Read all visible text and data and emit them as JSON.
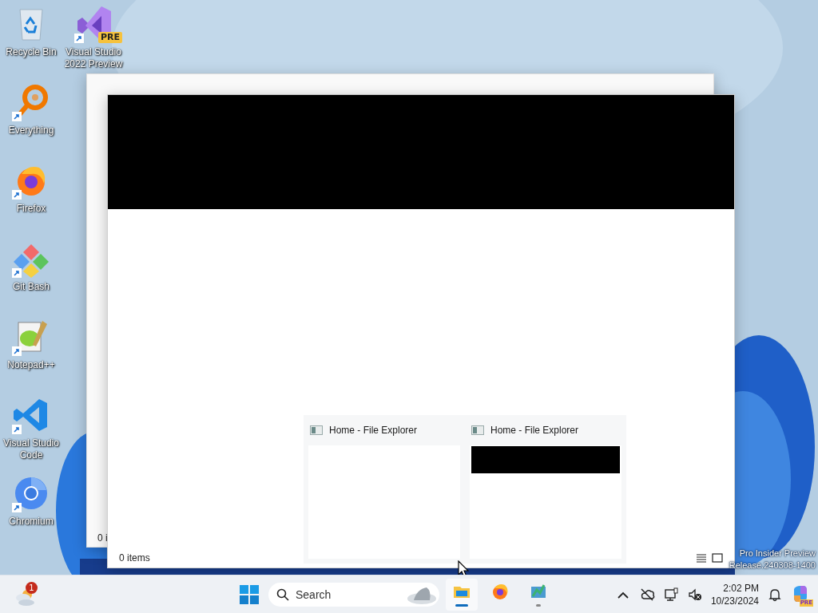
{
  "desktop": {
    "icons": [
      {
        "label": "Recycle Bin",
        "kind": "recycle",
        "shortcut": false
      },
      {
        "label": "Everything",
        "kind": "everything",
        "shortcut": true
      },
      {
        "label": "Firefox",
        "kind": "firefox",
        "shortcut": true
      },
      {
        "label": "Git Bash",
        "kind": "git",
        "shortcut": true
      },
      {
        "label": "Notepad++",
        "kind": "notepad",
        "shortcut": true
      },
      {
        "label": "Visual Studio Code",
        "kind": "vscode",
        "shortcut": true
      },
      {
        "label": "Chromium",
        "kind": "chromium",
        "shortcut": true
      },
      {
        "label": "Visual Studio 2022 Preview",
        "kind": "vs",
        "shortcut": true,
        "badge": "PRE"
      }
    ],
    "build_text": [
      "Pro Insider Preview",
      "Release.240308-1400"
    ]
  },
  "windows": [
    {
      "kind": "back",
      "status": "0 i"
    },
    {
      "kind": "front",
      "status": "0 items"
    }
  ],
  "thumbnails": [
    {
      "title": "Home - File Explorer",
      "redacted": false
    },
    {
      "title": "Home - File Explorer",
      "redacted": true
    }
  ],
  "taskbar": {
    "widgets_badge": "1",
    "search": {
      "placeholder": "Search"
    },
    "apps": [
      {
        "kind": "explorer",
        "running": true,
        "active": true
      },
      {
        "kind": "firefox",
        "running": false,
        "active": false
      },
      {
        "kind": "app",
        "running": true,
        "active": false
      }
    ],
    "tray": [
      {
        "kind": "chevron"
      },
      {
        "kind": "cloud"
      },
      {
        "kind": "network"
      },
      {
        "kind": "volume"
      }
    ],
    "time": "2:02 PM",
    "date": "10/23/2024",
    "copilot_badge": "PRE"
  }
}
